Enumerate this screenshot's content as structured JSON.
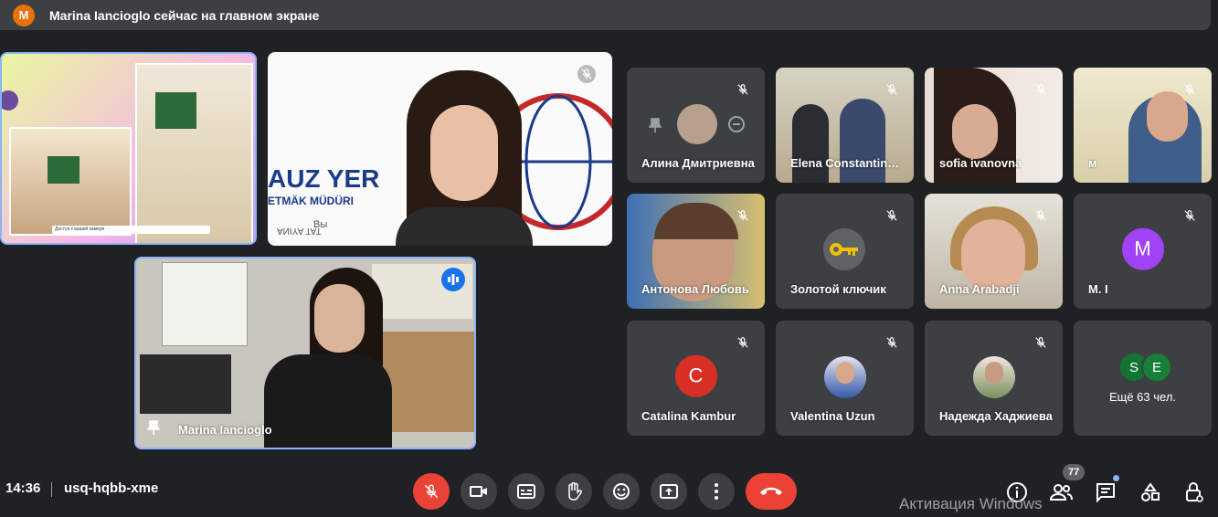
{
  "banner": {
    "avatar_letter": "M",
    "text": "Marina Iancioglo сейчас на главном экране"
  },
  "main": {
    "logo_top": "AUZ YER",
    "logo_mid": "ETMÄK MÜDÜRI",
    "logo_bot": "ANIYA TAT",
    "presenter_tile_name": "Вы",
    "speaking_tile_name": "Marina Iancioglo",
    "slide_caption": "Доступ к вашей камере"
  },
  "participants": [
    {
      "name": "Алина Дмитриевна"
    },
    {
      "name": "Elena Constantinovna"
    },
    {
      "name": "sofia ivanovna"
    },
    {
      "name": "м"
    },
    {
      "name": "Антонова Любовь"
    },
    {
      "name": "Золотой ключик"
    },
    {
      "name": "Anna Arabadji"
    },
    {
      "name": "M. I",
      "avatar_letter": "M",
      "avatar_color": "#a142f4"
    },
    {
      "name": "Catalina Kambur",
      "avatar_letter": "C",
      "avatar_color": "#d93025"
    },
    {
      "name": "Valentina Uzun"
    },
    {
      "name": "Надежда Хаджиева"
    }
  ],
  "more": {
    "label": "Ещё 63 чел.",
    "avatar1": "S",
    "avatar1_color": "#137333",
    "avatar2": "E",
    "avatar2_color": "#188038"
  },
  "bottom": {
    "time": "14:36",
    "meeting_code": "usq-hqbb-xme",
    "participants_count": "77",
    "watermark": "Активация Windows"
  },
  "icons": [
    "mic-off-icon",
    "camera-icon",
    "captions-icon",
    "hand-icon",
    "emoji-icon",
    "present-icon",
    "more-icon",
    "hangup-icon",
    "info-icon",
    "people-icon",
    "chat-icon",
    "activities-icon",
    "host-controls-icon"
  ]
}
